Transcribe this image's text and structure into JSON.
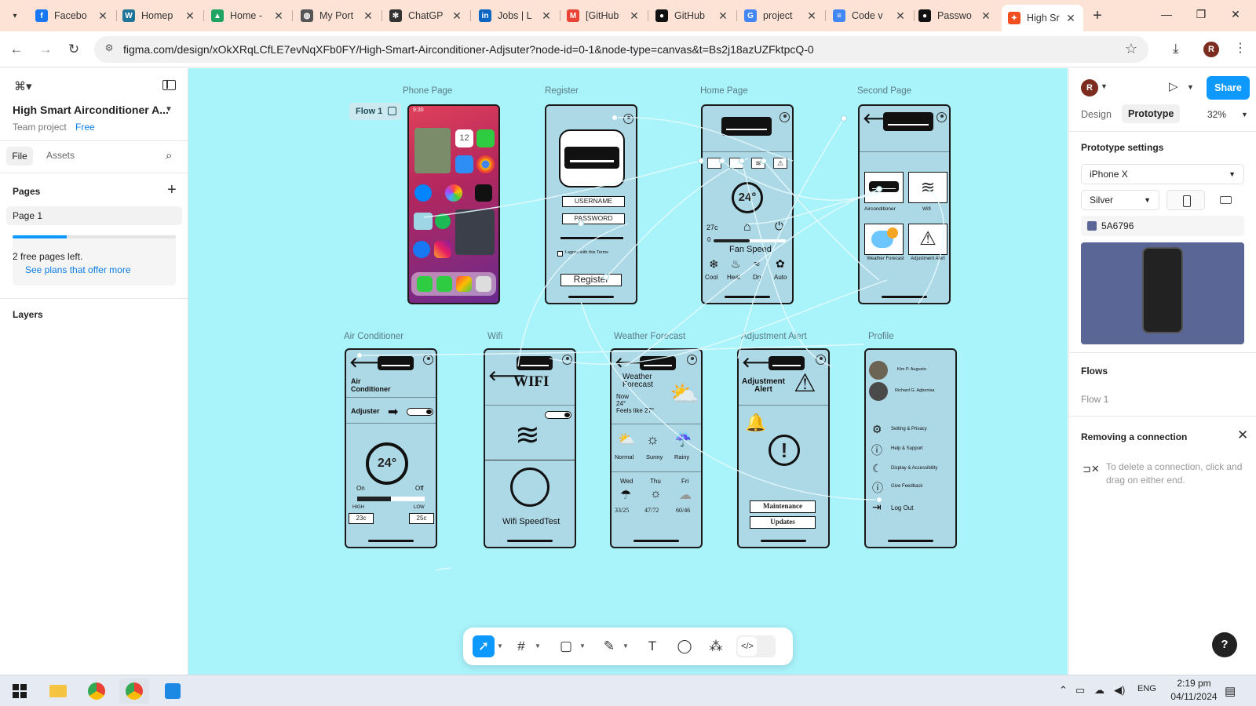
{
  "browser": {
    "tabs": [
      {
        "title": "Facebo",
        "icon": "facebook-icon",
        "color": "#1877f2",
        "glyph": "f"
      },
      {
        "title": "Homep",
        "icon": "wordpress-icon",
        "color": "#21759b",
        "glyph": "W"
      },
      {
        "title": "Home -",
        "icon": "google-drive-icon",
        "color": "#1fa463",
        "glyph": "▲"
      },
      {
        "title": "My Port",
        "icon": "globe-icon",
        "color": "#555555",
        "glyph": "◍"
      },
      {
        "title": "ChatGP",
        "icon": "chatgpt-icon",
        "color": "#333333",
        "glyph": "✻"
      },
      {
        "title": "Jobs | L",
        "icon": "linkedin-icon",
        "color": "#0a66c2",
        "glyph": "in"
      },
      {
        "title": "[GitHub",
        "icon": "gmail-icon",
        "color": "#ea4335",
        "glyph": "M"
      },
      {
        "title": "GitHub",
        "icon": "github-icon",
        "color": "#111111",
        "glyph": "●"
      },
      {
        "title": "project",
        "icon": "google-icon",
        "color": "#4285f4",
        "glyph": "G"
      },
      {
        "title": "Code v",
        "icon": "docs-icon",
        "color": "#4285f4",
        "glyph": "≡"
      },
      {
        "title": "Passwo",
        "icon": "github-icon",
        "color": "#111111",
        "glyph": "●"
      },
      {
        "title": "High Sr",
        "icon": "figma-icon",
        "color": "#f24e1e",
        "glyph": "✦",
        "active": true
      }
    ],
    "url": "figma.com/design/xOkXRqLCfLE7evNqXFb0FY/High-Smart-Airconditioner-Adjsuter?node-id=0-1&node-type=canvas&t=Bs2j18azUZFktpcQ-0",
    "profile_initial": "R"
  },
  "left_panel": {
    "file_name": "High Smart Airconditioner A...",
    "team_label": "Team project",
    "plan_label": "Free",
    "tab_file": "File",
    "tab_assets": "Assets",
    "pages_heading": "Pages",
    "page_item": "Page 1",
    "free_pages_text": "2 free pages left.",
    "free_pages_progress": 0.33,
    "see_plans": "See plans that offer more",
    "layers_heading": "Layers"
  },
  "canvas": {
    "background": "#a9f3fb",
    "flow_chip": "Flow 1",
    "frames": {
      "phone": "Phone Page",
      "register": "Register",
      "home": "Home Page",
      "second": "Second Page",
      "aircon": "Air Conditioner",
      "wifi": "Wifi",
      "weather": "Weather Forecast",
      "alert": "Adjustment Alert",
      "profile": "Profile"
    },
    "phone_page": {
      "time": "9:30",
      "date_tile": "12"
    },
    "register_page": {
      "username": "USERNAME",
      "password": "PASSWORD",
      "terms": "I agree with this Terms",
      "register_btn": "Register"
    },
    "home_page": {
      "temp_display": "24°",
      "temp_current": "27c",
      "slider_min": "0",
      "fan_speed": "Fan Speed",
      "modes": [
        "Cool",
        "Heat",
        "Dry",
        "Auto"
      ]
    },
    "second_page": {
      "tiles": [
        "Airconditioner",
        "Wifi",
        "Weather Forecast",
        "Adjustment Alert"
      ]
    },
    "aircon_page": {
      "title_1": "Air",
      "title_2": "Conditioner",
      "adjuster": "Adjuster",
      "temp": "24°",
      "on": "On",
      "off": "Off",
      "high": "HIGH",
      "low": "LOW",
      "high_val": "23c",
      "low_val": "25c"
    },
    "wifi_page": {
      "title": "WIFI",
      "speedtest": "Wifi SpeedTest"
    },
    "weather_page": {
      "title_1": "Weather",
      "title_2": "Forecast",
      "now": "Now",
      "now_temp": "24°",
      "feels": "Feels like 27°",
      "conditions": [
        "Normal",
        "Sunny",
        "Rainy"
      ],
      "days": [
        "Wed",
        "Thu",
        "Fri"
      ],
      "day_temps": [
        "33/25",
        "47/72",
        "60/46"
      ]
    },
    "alert_page": {
      "title_1": "Adjustment",
      "title_2": "Alert",
      "maintenance": "Maintenance",
      "updates": "Updates"
    },
    "profile_page": {
      "users": [
        "Kim P. Augusto",
        "Richard G. Agbonisa"
      ],
      "menu": [
        "Setting & Privacy",
        "Help & Support",
        "Display & Accessibility",
        "Give Feedback",
        "Log Out"
      ]
    }
  },
  "right_panel": {
    "user_initial": "R",
    "share": "Share",
    "tab_design": "Design",
    "tab_prototype": "Prototype",
    "zoom": "32%",
    "proto_heading": "Prototype settings",
    "device": "iPhone X",
    "device_color": "Silver",
    "bg_hex": "5A6796",
    "bg_color": "#5a6796",
    "flows_heading": "Flows",
    "flow_item": "Flow 1",
    "conn_heading": "Removing a connection",
    "conn_text": "To delete a connection, click and drag on either end.",
    "help": "?"
  },
  "taskbar": {
    "language": "ENG",
    "time": "2:19 pm",
    "date": "04/11/2024"
  }
}
